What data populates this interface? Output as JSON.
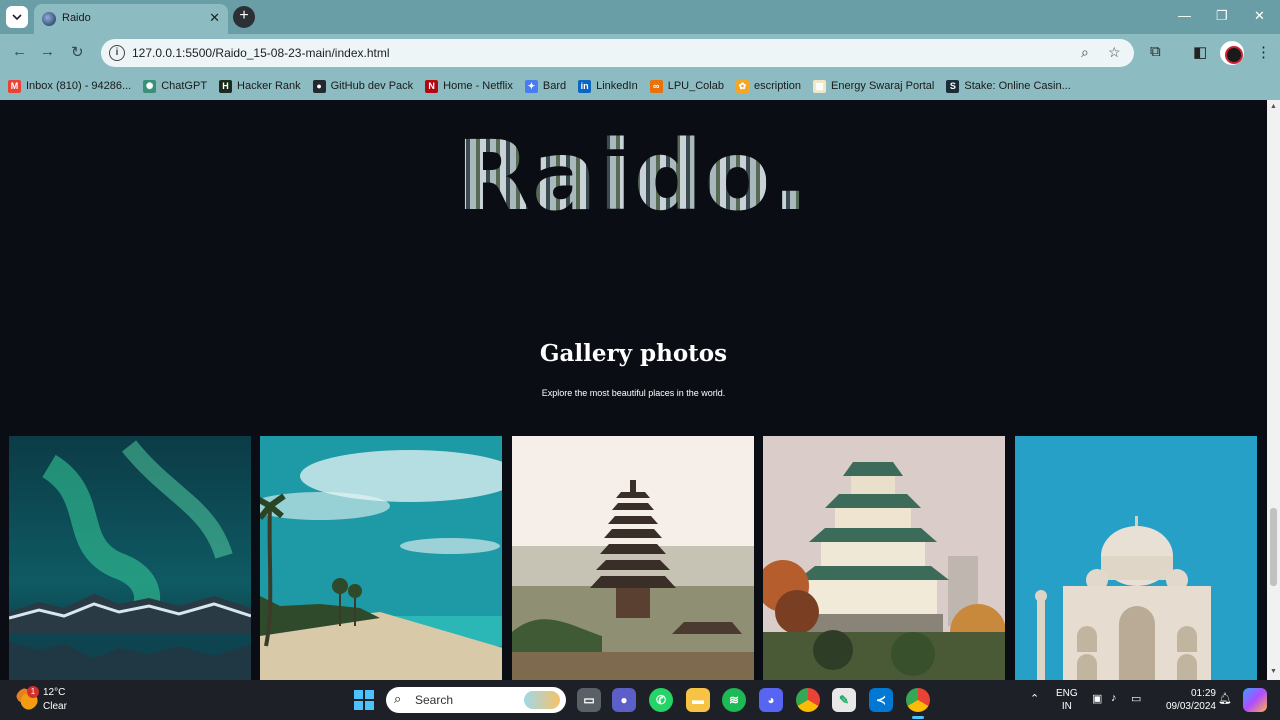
{
  "browser": {
    "tab_title": "Raido",
    "url": "127.0.0.1:5500/Raido_15-08-23-main/index.html",
    "new_tab": "+",
    "close_tab": "✕"
  },
  "bookmarks": [
    {
      "label": "Inbox (810) - 94286...",
      "icon": "gmail-icon",
      "color": "#ea4335",
      "glyph": "M"
    },
    {
      "label": "ChatGPT",
      "icon": "chatgpt-icon",
      "color": "#3a8f79",
      "glyph": "✺"
    },
    {
      "label": "Hacker Rank",
      "icon": "hackerrank-icon",
      "color": "#1b2a1b",
      "glyph": "H"
    },
    {
      "label": "GitHub dev Pack",
      "icon": "github-icon",
      "color": "#24292e",
      "glyph": "●"
    },
    {
      "label": "Home - Netflix",
      "icon": "netflix-icon",
      "color": "#b20710",
      "glyph": "N"
    },
    {
      "label": "Bard",
      "icon": "bard-icon",
      "color": "#4a7cf0",
      "glyph": "✦"
    },
    {
      "label": "LinkedIn",
      "icon": "linkedin-icon",
      "color": "#0a66c2",
      "glyph": "in"
    },
    {
      "label": "LPU_Colab",
      "icon": "colab-icon",
      "color": "#e8710a",
      "glyph": "∞"
    },
    {
      "label": "escription",
      "icon": "bookmark-site-icon",
      "color": "#f5a623",
      "glyph": "✿"
    },
    {
      "label": "Energy Swaraj Portal",
      "icon": "energy-portal-icon",
      "color": "#f0e6c8",
      "glyph": "▦"
    },
    {
      "label": "Stake: Online Casin...",
      "icon": "stake-icon",
      "color": "#1a2c38",
      "glyph": "S"
    }
  ],
  "page": {
    "logo": "Raido.",
    "gallery_title": "Gallery photos",
    "gallery_subtitle": "Explore the most beautiful places in the world."
  },
  "gallery": [
    {
      "name": "photo-aurora",
      "subject": "Northern lights over mountains and lake"
    },
    {
      "name": "photo-beach",
      "subject": "Tropical beach with palm trees"
    },
    {
      "name": "photo-pagoda",
      "subject": "Bali temple pagoda"
    },
    {
      "name": "photo-castle",
      "subject": "Osaka castle"
    },
    {
      "name": "photo-taj-mahal",
      "subject": "Taj Mahal"
    }
  ],
  "taskbar": {
    "weather_temp": "12°C",
    "weather_condition": "Clear",
    "weather_badge": "1",
    "search_label": "Search",
    "lang_primary": "ENG",
    "lang_secondary": "IN",
    "time": "01:29",
    "date": "09/03/2024"
  },
  "colors": {
    "page_background": "#0a0d14",
    "browser_frame": "#8cbcc2",
    "taskbar": "#1d2127",
    "accent": "#4cc2ff"
  }
}
